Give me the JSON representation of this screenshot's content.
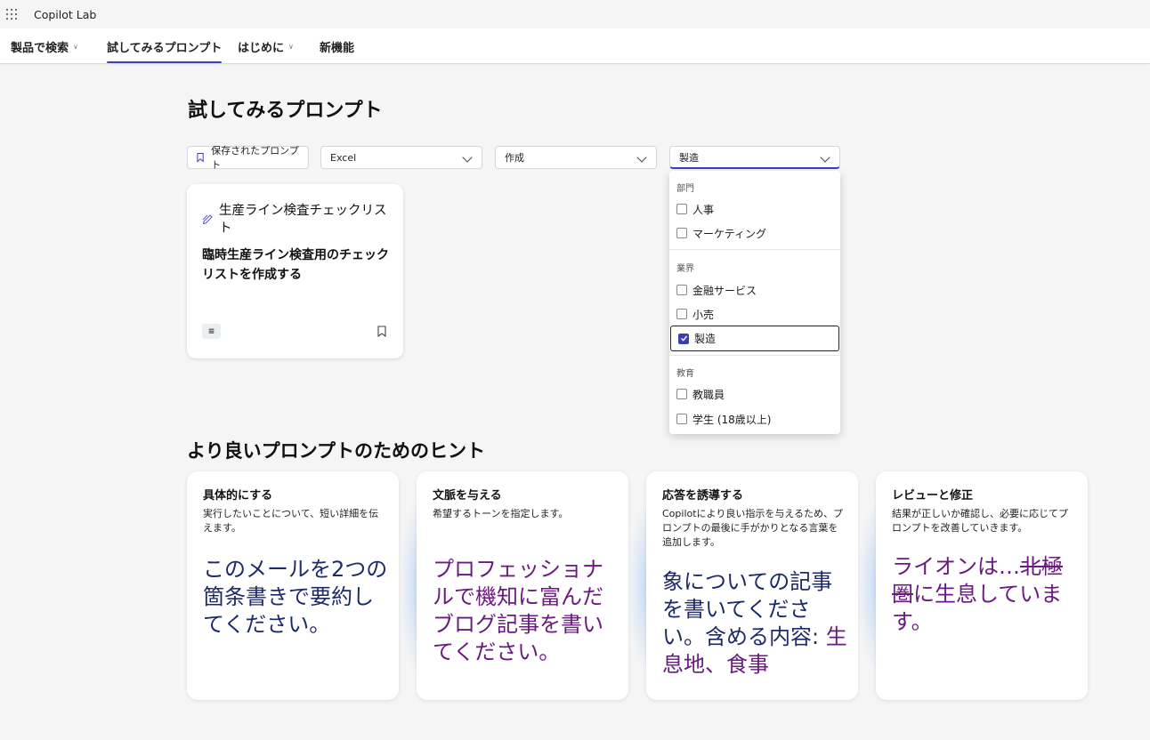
{
  "app": {
    "title": "Copilot Lab"
  },
  "nav": {
    "items": [
      {
        "label": "製品で検索",
        "has_chevron": true
      },
      {
        "label": "試してみるプロンプト",
        "active": true
      },
      {
        "label": "はじめに",
        "has_chevron": true
      },
      {
        "label": "新機能"
      }
    ]
  },
  "page": {
    "title": "試してみるプロンプト"
  },
  "filters": {
    "saved_label": "保存されたプロンプト",
    "app_value": "Excel",
    "action_value": "作成",
    "industry_value": "製造"
  },
  "prompt_card": {
    "title": "生産ライン検査チェックリスト",
    "description": "臨時生産ライン検査用のチェックリストを作成する",
    "app_icon": "excel-icon"
  },
  "dropdown": {
    "groups": [
      {
        "label": "部門",
        "options": [
          {
            "label": "人事",
            "checked": false
          },
          {
            "label": "マーケティング",
            "checked": false
          }
        ]
      },
      {
        "label": "業界",
        "options": [
          {
            "label": "金融サービス",
            "checked": false
          },
          {
            "label": "小売",
            "checked": false
          },
          {
            "label": "製造",
            "checked": true
          }
        ]
      },
      {
        "label": "教育",
        "options": [
          {
            "label": "教職員",
            "checked": false
          },
          {
            "label": "学生 (18歳以上)",
            "checked": false
          }
        ]
      }
    ]
  },
  "tips": {
    "section_title": "より良いプロンプトのためのヒント",
    "cards": [
      {
        "title": "具体的にする",
        "description": "実行したいことについて、短い詳細を伝えます。",
        "example": "このメールを2つの箇条書きで要約してください。",
        "color": "#1c2a6b"
      },
      {
        "title": "文脈を与える",
        "description": "希望するトーンを指定します。",
        "example": "プロフェッショナルで機知に富んだブログ記事を書いてください。",
        "color": "#6b1a80"
      },
      {
        "title": "応答を誘導する",
        "description": "Copilotにより良い指示を与えるため、プロンプトの最後に手がかりとなる言葉を追加します。",
        "example_main": "象についての記事を書いてください。含める内容: ",
        "example_hint": "生息地、食事",
        "color": "#1c2a6b",
        "hint_color": "#6b1a80"
      },
      {
        "title": "レビューと修正",
        "description": "結果が正しいか確認し、必要に応じてプロンプトを改善していきます。",
        "example_prefix": "ライオンは…",
        "example_struck": "北極圏",
        "example_suffix": "に生息しています。",
        "color": "#6b1a80"
      }
    ]
  },
  "colors": {
    "accent": "#3b3fb6",
    "navy": "#1c2a6b",
    "purple": "#6b1a80"
  }
}
